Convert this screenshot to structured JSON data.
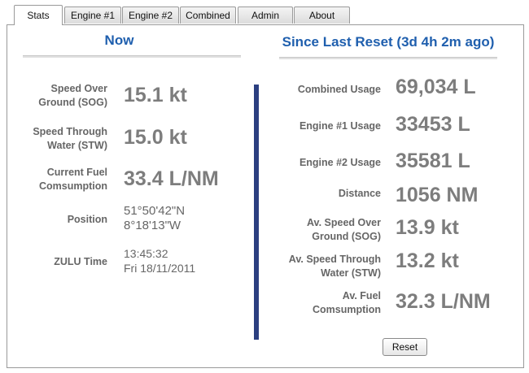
{
  "tabs": [
    {
      "label": "Stats",
      "active": true
    },
    {
      "label": "Engine #1",
      "active": false
    },
    {
      "label": "Engine #2",
      "active": false
    },
    {
      "label": "Combined",
      "active": false
    },
    {
      "label": "Admin",
      "active": false
    },
    {
      "label": "About",
      "active": false
    }
  ],
  "now": {
    "title": "Now",
    "sog": {
      "label": [
        "Speed Over",
        "Ground (SOG)"
      ],
      "value": "15.1 kt"
    },
    "stw": {
      "label": [
        "Speed Through",
        "Water (STW)"
      ],
      "value": "15.0 kt"
    },
    "fuel": {
      "label": [
        "Current Fuel",
        "Comsumption"
      ],
      "value": "33.4 L/NM"
    },
    "position": {
      "label": "Position",
      "lat": "51°50'42\"N",
      "lon": "8°18'13\"W"
    },
    "zulu": {
      "label": "ZULU Time",
      "time": "13:45:32",
      "date": "Fri 18/11/2011"
    }
  },
  "since": {
    "title": "Since Last Reset (3d 4h 2m ago)",
    "combined": {
      "label": "Combined Usage",
      "value": "69,034 L"
    },
    "engine1": {
      "label": "Engine #1 Usage",
      "value": "33453 L"
    },
    "engine2": {
      "label": "Engine #2 Usage",
      "value": "35581 L"
    },
    "distance": {
      "label": "Distance",
      "value": "1056 NM"
    },
    "av_sog": {
      "label": [
        "Av. Speed Over",
        "Ground (SOG)"
      ],
      "value": "13.9 kt"
    },
    "av_stw": {
      "label": [
        "Av. Speed Through",
        "Water (STW)"
      ],
      "value": "13.2 kt"
    },
    "av_fuel": {
      "label": [
        "Av. Fuel",
        "Comsumption"
      ],
      "value": "32.3 L/NM"
    }
  },
  "reset_label": "Reset",
  "colors": {
    "title": "#1f5fae",
    "divider": "#2b3f80",
    "value": "#7d7d7d",
    "label": "#666666"
  }
}
